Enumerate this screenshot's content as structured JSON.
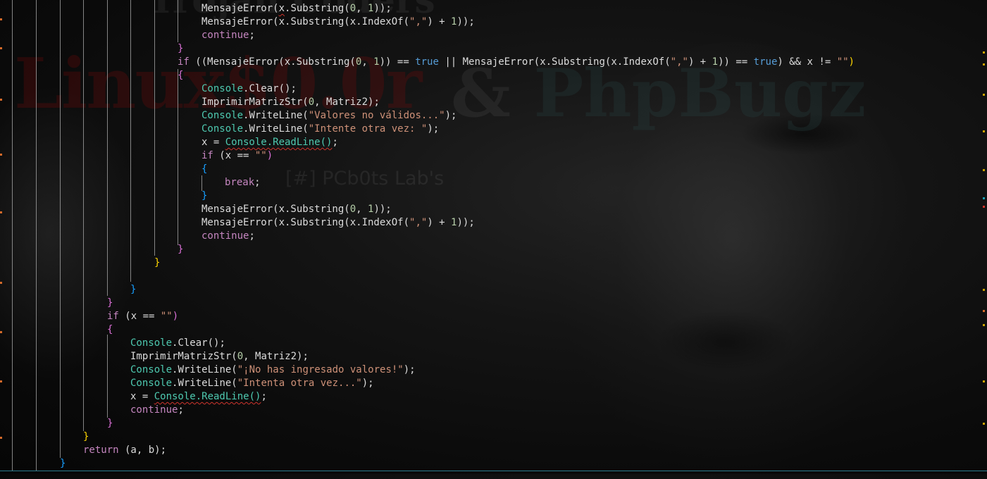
{
  "editor": {
    "language": "csharp",
    "colors": {
      "keyword": "#c586c0",
      "type": "#4ec9b0",
      "string": "#ce9178",
      "number": "#b5cea8",
      "bool": "#569cd6",
      "error_squiggle": "#d0342c"
    },
    "lines": [
      [
        "",
        "MensajeError(",
        "x",
        ".Substring(",
        "0",
        ", ",
        "1",
        "));"
      ],
      [
        "",
        "MensajeError(",
        "x",
        ".Substring(x.IndexOf(",
        "\",\"",
        ") + ",
        "1",
        "));"
      ],
      [
        "continue",
        ";"
      ],
      [
        "}"
      ],
      [
        "if",
        " ((MensajeError(x.Substring(",
        "0",
        ", ",
        "1",
        ")) == ",
        "true",
        " || MensajeError(x.Substring(x.IndexOf(",
        "\",\"",
        ") + ",
        "1",
        ")) == ",
        "true",
        ") && x != ",
        "\"\"",
        ")"
      ],
      [
        "{"
      ],
      [
        "Console",
        ".Clear();"
      ],
      [
        "ImprimirMatrizStr(",
        "0",
        ", Matriz2);"
      ],
      [
        "Console",
        ".WriteLine(",
        "\"Valores no válidos...\"",
        ");"
      ],
      [
        "Console",
        ".WriteLine(",
        "\"Intente otra vez: \"",
        ");"
      ],
      [
        "x = ",
        "Console.ReadLine()",
        ";"
      ],
      [
        "if",
        " (x == ",
        "\"\"",
        ")"
      ],
      [
        "{"
      ],
      [
        "break",
        ";"
      ],
      [
        "}"
      ],
      [
        "MensajeError(x.Substring(",
        "0",
        ", ",
        "1",
        "));"
      ],
      [
        "MensajeError(x.Substring(x.IndexOf(",
        "\",\"",
        ") + ",
        "1",
        "));"
      ],
      [
        "continue",
        ";"
      ],
      [
        "}"
      ],
      [
        "}"
      ],
      [
        ""
      ],
      [
        "}"
      ],
      [
        "}"
      ],
      [
        "if",
        " (x == ",
        "\"\"",
        ")"
      ],
      [
        "{"
      ],
      [
        "Console",
        ".Clear();"
      ],
      [
        "ImprimirMatrizStr(",
        "0",
        ", Matriz2);"
      ],
      [
        "Console",
        ".WriteLine(",
        "\"¡No has ingresado valores!\"",
        ");"
      ],
      [
        "Console",
        ".WriteLine(",
        "\"Intenta otra vez...\"",
        ");"
      ],
      [
        "x = ",
        "Console.ReadLine()",
        ";"
      ],
      [
        "continue",
        ";"
      ],
      [
        "}"
      ],
      [
        "}"
      ],
      [
        "return",
        " (a, b);"
      ],
      [
        "}"
      ]
    ]
  },
  "background": {
    "watermark_top": "Trojan Coders",
    "watermark_left": "Linux$0.0r",
    "watermark_amp": "&",
    "watermark_right": "PhpBugz",
    "watermark_sub": "[#] PCb0ts Lab's"
  }
}
